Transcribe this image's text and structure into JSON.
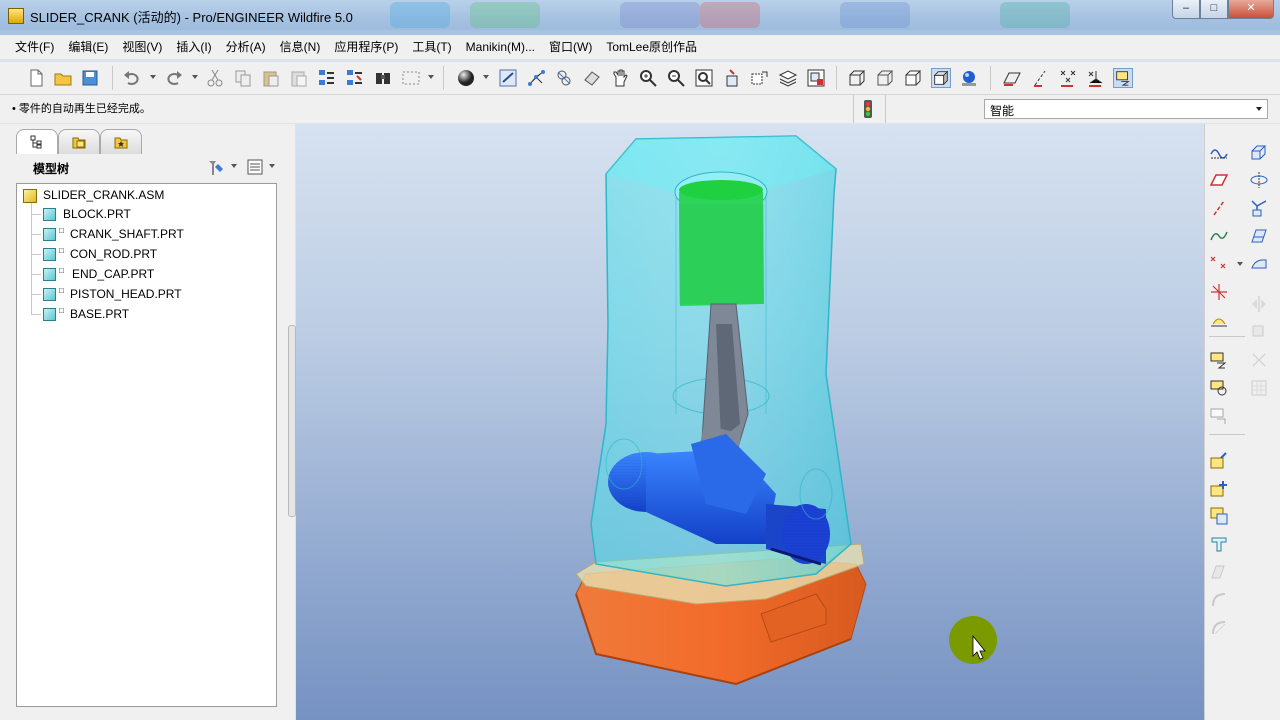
{
  "window": {
    "title": "SLIDER_CRANK (活动的) - Pro/ENGINEER Wildfire 5.0",
    "controls": {
      "minimize": "–",
      "maximize": "□",
      "close": "✕"
    }
  },
  "menu": [
    {
      "label": "文件(F)"
    },
    {
      "label": "编辑(E)"
    },
    {
      "label": "视图(V)"
    },
    {
      "label": "插入(I)"
    },
    {
      "label": "分析(A)"
    },
    {
      "label": "信息(N)"
    },
    {
      "label": "应用程序(P)"
    },
    {
      "label": "工具(T)"
    },
    {
      "label": "Manikin(M)..."
    },
    {
      "label": "窗口(W)"
    },
    {
      "label": "TomLee原创作品"
    }
  ],
  "status": {
    "message": "• 零件的自动再生已经完成。",
    "filter_value": "智能"
  },
  "model_tree": {
    "header": "模型树",
    "root": "SLIDER_CRANK.ASM",
    "items": [
      {
        "label": "BLOCK.PRT"
      },
      {
        "label": "CRANK_SHAFT.PRT"
      },
      {
        "label": "CON_ROD.PRT"
      },
      {
        "label": "END_CAP.PRT"
      },
      {
        "label": "PISTON_HEAD.PRT"
      },
      {
        "label": "BASE.PRT"
      }
    ]
  },
  "toolbar": {
    "icons": [
      "new-icon",
      "open-icon",
      "save-icon",
      "undo-icon",
      "redo-icon",
      "cut-icon",
      "copy-icon",
      "paste-icon",
      "paste-special-icon",
      "regenerate-icon",
      "regen-manager-icon",
      "find-icon",
      "select-box-icon",
      "shading-sphere-icon",
      "spin-center-icon",
      "csys-display-icon",
      "datum-display-icon",
      "model-display-icon",
      "pan-icon",
      "zoom-in-icon",
      "zoom-out-icon",
      "refit-icon",
      "reorient-icon",
      "saved-views-icon",
      "layers-icon",
      "view-manager-icon",
      "wireframe-icon",
      "hidden-line-icon",
      "no-hidden-icon",
      "shaded-icon",
      "enhanced-realism-icon",
      "plane-display-icon",
      "axis-display-icon",
      "point-display-icon",
      "csys-toggle-icon",
      "annotation-display-icon"
    ]
  },
  "right_toolbar": {
    "icons": [
      "sketched-curve-icon",
      "datum-plane-icon",
      "datum-axis-icon",
      "datum-curve-icon",
      "datum-point-icon",
      "datum-csys-icon",
      "analysis-icon",
      "annotation-icon",
      "component-place-icon",
      "component-create-icon",
      "assemble-icon",
      "package-icon",
      "mirror-icon",
      "repeat-icon",
      "merge-icon",
      "cut-out-icon",
      "flexible-icon",
      "sketch-icon",
      "extrude-icon",
      "revolve-icon",
      "sweep-icon",
      "blend-icon",
      "hole-icon",
      "round-icon",
      "chamfer-icon",
      "shell-icon",
      "pattern-icon"
    ]
  },
  "colors": {
    "block": "#4fe0ea",
    "base": "#f26b2a",
    "crank": "#1f64e8",
    "piston": "#2ed35a",
    "cursor_highlight": "#7a9a00"
  }
}
